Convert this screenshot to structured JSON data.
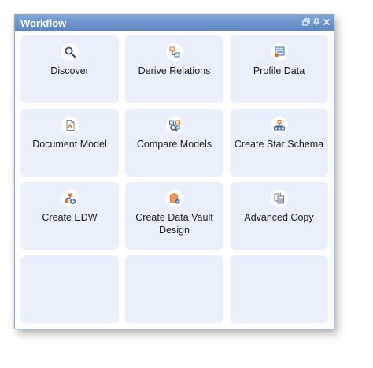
{
  "window": {
    "title": "Workflow",
    "controls": [
      "restore-icon",
      "pin-icon",
      "close-icon"
    ]
  },
  "tiles": [
    {
      "label": "Discover",
      "icon": "search-icon"
    },
    {
      "label": "Derive Relations",
      "icon": "derive-relations-icon"
    },
    {
      "label": "Profile Data",
      "icon": "profile-data-icon"
    },
    {
      "label": "Document Model",
      "icon": "document-model-icon"
    },
    {
      "label": "Compare Models",
      "icon": "compare-models-icon"
    },
    {
      "label": "Create Star Schema",
      "icon": "star-schema-icon"
    },
    {
      "label": "Create EDW",
      "icon": "create-edw-icon"
    },
    {
      "label": "Create Data Vault Design",
      "icon": "data-vault-icon"
    },
    {
      "label": "Advanced Copy",
      "icon": "advanced-copy-icon"
    }
  ],
  "colors": {
    "titlebar": "#6a93c9",
    "tile": "#e9f0fb",
    "accent_orange": "#e8742a",
    "accent_blue": "#3c6fb0"
  }
}
